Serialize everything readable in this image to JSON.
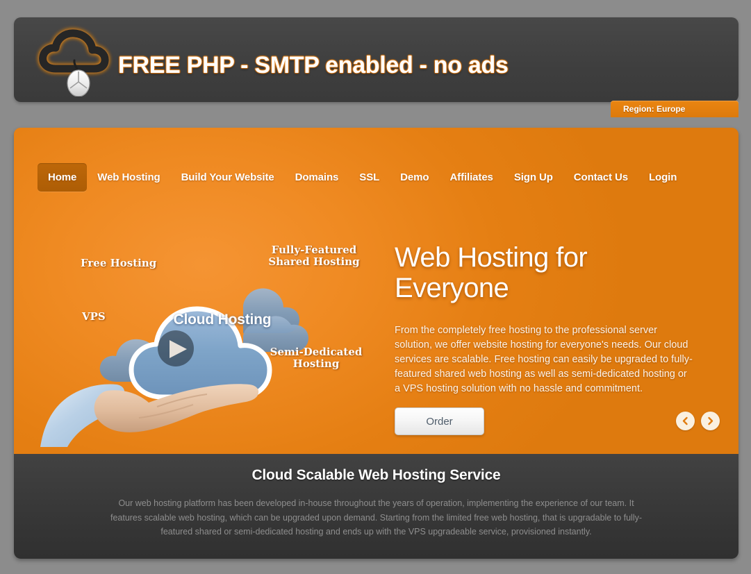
{
  "header": {
    "logo_icon": "cloud-with-mouse-icon",
    "title": "FREE PHP - SMTP enabled - no ads",
    "region_badge": "Region: Europe"
  },
  "nav": {
    "items": [
      {
        "label": "Home",
        "active": true
      },
      {
        "label": "Web Hosting",
        "active": false
      },
      {
        "label": "Build Your Website",
        "active": false
      },
      {
        "label": "Domains",
        "active": false
      },
      {
        "label": "SSL",
        "active": false
      },
      {
        "label": "Demo",
        "active": false
      },
      {
        "label": "Affiliates",
        "active": false
      },
      {
        "label": "Sign Up",
        "active": false
      },
      {
        "label": "Contact Us",
        "active": false
      },
      {
        "label": "Login",
        "active": false
      }
    ]
  },
  "illustration": {
    "center_label": "Cloud Hosting",
    "label_free": "Free Hosting",
    "label_vps": "VPS",
    "label_shared": "Fully-Featured Shared Hosting",
    "label_semi": "Semi-Dedicated Hosting",
    "play_icon": "play-button-icon"
  },
  "hero": {
    "title": "Web Hosting for Everyone",
    "paragraph": "From the completely free hosting to the professional server solution, we offer website hosting for everyone's needs. Our cloud services are scalable. Free hosting can easily be upgraded to fully-featured shared web hosting as well as semi-dedicated hosting or a VPS hosting solution with no hassle and commitment.",
    "order_label": "Order",
    "prev_icon": "chevron-left-icon",
    "next_icon": "chevron-right-icon"
  },
  "bottom": {
    "title": "Cloud Scalable Web Hosting Service",
    "paragraph": "Our web hosting platform has been developed in-house throughout the years of operation, implementing the experience of our team. It features scalable web hosting, which can be upgraded upon demand. Starting from the limited free web hosting, that is upgradable to fully-featured shared or semi-dedicated hosting and ends up with the VPS upgradeable service, provisioned instantly."
  },
  "colors": {
    "page_background": "#8c8c8c",
    "header_dark": "#3f3f3f",
    "brand_orange": "#e57f13",
    "active_tab": "#b35f08",
    "bottom_dark": "#383838",
    "badge_orange": "#e3800e"
  }
}
